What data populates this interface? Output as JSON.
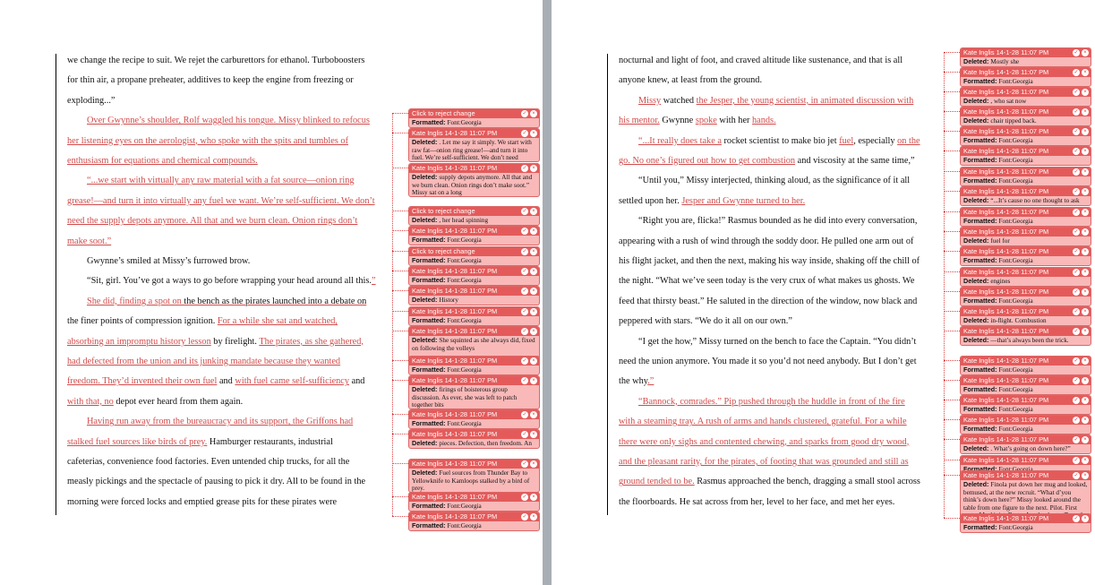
{
  "left_page": {
    "lines": [
      [
        {
          "t": "we change the recipe to suit. We rejet the carburettors for ethanol. Turboboosters"
        }
      ],
      [
        {
          "t": "for thin air, a propane preheater, additives to keep the engine from freezing or"
        }
      ],
      [
        {
          "t": "exploding...”"
        }
      ],
      [
        {
          "t": "Over Gwynne’s shoulder, Rolf waggled his tongue. Missy blinked to refocus",
          "c": "ins"
        }
      ],
      [
        {
          "t": "her listening eyes on the aerologist, who spoke with the spits and tumbles of",
          "c": "ins"
        }
      ],
      [
        {
          "t": "enthusiasm for equations and chemical compounds.",
          "c": "ins"
        }
      ],
      [
        {
          "t": "“...we start with virtually any raw material with a fat source—onion ring",
          "c": "ins"
        }
      ],
      [
        {
          "t": "grease!—and turn it into virtually any fuel we want. We’re self-sufficient. We don’t",
          "c": "ins"
        }
      ],
      [
        {
          "t": "need the supply depots anymore. All that and we burn clean. Onion rings don’t",
          "c": "ins"
        }
      ],
      [
        {
          "t": "make soot.”",
          "c": "ins"
        }
      ],
      [
        {
          "t": "Gwynne’s smiled at Missy’s furrowed brow."
        }
      ],
      [
        {
          "t": "“Sit, girl. You’ve got a ways to go before wrapping your head around all this."
        },
        {
          "t": "”",
          "c": "ins"
        }
      ],
      [
        {
          "t": "She did, finding a spot on ",
          "c": "ins"
        },
        {
          "t": "the bench as the pirates launched into a debate on",
          "c": "del"
        }
      ],
      [
        {
          "t": "the finer points of compression ignition. "
        },
        {
          "t": "For a while she sat and watched,",
          "c": "ins"
        }
      ],
      [
        {
          "t": "absorbing an impromptu history lesson",
          "c": "ins"
        },
        {
          "t": " by firelight. "
        },
        {
          "t": "The pirates, as she gathered,",
          "c": "ins"
        }
      ],
      [
        {
          "t": "had defected from the union and its junking mandate because they wanted",
          "c": "ins"
        }
      ],
      [
        {
          "t": "freedom. They’d invented their own fuel",
          "c": "ins"
        },
        {
          "t": " and "
        },
        {
          "t": "with fuel came self-sufficiency",
          "c": "ins"
        },
        {
          "t": " and"
        }
      ],
      [
        {
          "t": "with that, no",
          "c": "ins"
        },
        {
          "t": " depot ever heard from them again."
        }
      ],
      [
        {
          "t": "Having run away from the bureaucracy and its support, the Griffons had",
          "c": "ins"
        }
      ],
      [
        {
          "t": "stalked fuel sources like birds of prey.",
          "c": "ins"
        },
        {
          "t": " Hamburger restaurants, industrial"
        }
      ],
      [
        {
          "t": "cafeterias, convenience food factories. Even untended chip trucks, for all the"
        }
      ],
      [
        {
          "t": "measly pickings and the spectacle of pausing to pick it dry. All to be found in the"
        }
      ],
      [
        {
          "t": "morning were forced locks and emptied grease pits for these pirates were"
        }
      ]
    ],
    "balloons": [
      {
        "head": "Click to reject change",
        "label": "Formatted:",
        "text": "Font:Georgia"
      },
      {
        "head": "Kate Inglis 14-1-28 11:07 PM",
        "label": "Deleted:",
        "text": ". Let me say it simply. We start with raw fat—onion ring grease!—and turn it into fuel. We’re self-sufficient. We don’t need"
      },
      {
        "head": "Kate Inglis 14-1-28 11:07 PM",
        "label": "Deleted:",
        "text": "supply depots anymore. All that and we burn clean. Onion rings don’t make soot.” Missy sat on a long"
      },
      {
        "head": "Click to reject change",
        "label": "Deleted:",
        "text": ", her head spinning"
      },
      {
        "head": "Kate Inglis 14-1-28 11:07 PM",
        "label": "Formatted:",
        "text": "Font:Georgia"
      },
      {
        "head": "Click to reject change",
        "label": "Formatted:",
        "text": "Font:Georgia"
      },
      {
        "head": "Kate Inglis 14-1-28 11:07 PM",
        "label": "Formatted:",
        "text": "Font:Georgia"
      },
      {
        "head": "Kate Inglis 14-1-28 11:07 PM",
        "label": "Deleted:",
        "text": "History"
      },
      {
        "head": "Kate Inglis 14-1-28 11:07 PM",
        "label": "Formatted:",
        "text": "Font:Georgia"
      },
      {
        "head": "Kate Inglis 14-1-28 11:07 PM",
        "label": "Deleted:",
        "text": "She squinted as she always did, fixed on following the volleys"
      },
      {
        "head": "Kate Inglis 14-1-28 11:07 PM",
        "label": "Formatted:",
        "text": "Font:Georgia"
      },
      {
        "head": "Kate Inglis 14-1-28 11:07 PM",
        "label": "Deleted:",
        "text": "firings of boisterous group discussion. As ever, she was left to patch together bits"
      },
      {
        "head": "Kate Inglis 14-1-28 11:07 PM",
        "label": "Formatted:",
        "text": "Font:Georgia"
      },
      {
        "head": "Kate Inglis 14-1-28 11:07 PM",
        "label": "Deleted:",
        "text": "pieces. Defection, then freedom. An angry union. No"
      },
      {
        "head": "Kate Inglis 14-1-28 11:07 PM",
        "label": "Deleted:",
        "text": "Fuel sources from Thunder Bay to Yellowknife to Kamloops stalked by a bird of prey."
      },
      {
        "head": "Kate Inglis 14-1-28 11:07 PM",
        "label": "Formatted:",
        "text": "Font:Georgia"
      },
      {
        "head": "Kate Inglis 14-1-28 11:07 PM",
        "label": "Formatted:",
        "text": "Font:Georgia"
      }
    ]
  },
  "right_page": {
    "lines": [
      [
        {
          "t": "nocturnal and light of foot, and craved altitude like sustenance, and that is all"
        }
      ],
      [
        {
          "t": "anyone knew, at least from the ground."
        }
      ],
      [
        {
          "t": "Missy",
          "c": "ins"
        },
        {
          "t": " watched "
        },
        {
          "t": "the Jesper, the young scientist, in animated discussion with",
          "c": "ins"
        }
      ],
      [
        {
          "t": "his mentor.",
          "c": "ins"
        },
        {
          "t": " Gwynne "
        },
        {
          "t": "spoke",
          "c": "ins"
        },
        {
          "t": " with her "
        },
        {
          "t": "hands.",
          "c": "ins"
        }
      ],
      [
        {
          "t": "“...It really does take a",
          "c": "ins"
        },
        {
          "t": " rocket scientist to make bio jet "
        },
        {
          "t": "fuel",
          "c": "ins"
        },
        {
          "t": ", especially "
        },
        {
          "t": "on the",
          "c": "ins"
        }
      ],
      [
        {
          "t": "go. No one’s figured out how to get combustion",
          "c": "ins"
        },
        {
          "t": " and viscosity at the same time,”"
        }
      ],
      [
        {
          "t": "“Until you,” Missy interjected, thinking aloud, as the significance of it all"
        }
      ],
      [
        {
          "t": "settled upon her. "
        },
        {
          "t": "Jesper and Gwynne turned to her.",
          "c": "ins"
        }
      ],
      [
        {
          "t": "“Right you are, flicka!” Rasmus bounded as he did into every conversation,"
        }
      ],
      [
        {
          "t": "appearing with a rush of wind through the soddy door. He pulled one arm out of"
        }
      ],
      [
        {
          "t": "his flight jacket, and then the next, making his way inside, shaking off the chill of"
        }
      ],
      [
        {
          "t": "the night. “What we’ve seen today is the very crux of what makes us ghosts. We"
        }
      ],
      [
        {
          "t": "feed that thirsty beast.” He saluted in the direction of the window, now black and"
        }
      ],
      [
        {
          "t": "peppered with stars. “We do it all on our own.”"
        }
      ],
      [
        {
          "t": "“I get the how,” Missy turned on the bench to face the Captain. “You didn’t"
        }
      ],
      [
        {
          "t": "need the union anymore. You made it so you’d not need anybody. But I don’t get"
        }
      ],
      [
        {
          "t": "the why"
        },
        {
          "t": ".”",
          "c": "ins"
        }
      ],
      [
        {
          "t": "“Bannock, comrades.” Pip pushed through the huddle in front of the fire",
          "c": "ins"
        }
      ],
      [
        {
          "t": "with a steaming tray. A rush of arms and hands clustered, grateful. For a while",
          "c": "ins"
        }
      ],
      [
        {
          "t": "there were only sighs and contented chewing, and sparks from good dry wood,",
          "c": "ins"
        }
      ],
      [
        {
          "t": "and the pleasant rarity, for the pirates, of footing that was grounded and still as",
          "c": "ins"
        }
      ],
      [
        {
          "t": "ground tended to be.",
          "c": "ins"
        },
        {
          "t": " Rasmus approached the bench, dragging a small stool across"
        }
      ],
      [
        {
          "t": "the floorboards. He sat across from her, level to her face, and met her eyes."
        }
      ]
    ],
    "balloons": [
      {
        "head": "Kate Inglis 14-1-28 11:07 PM",
        "label": "Deleted:",
        "text": "Mostly she"
      },
      {
        "head": "Kate Inglis 14-1-28 11:07 PM",
        "label": "Formatted:",
        "text": "Font:Georgia"
      },
      {
        "head": "Kate Inglis 14-1-28 11:07 PM",
        "label": "Deleted:",
        "text": ", who sat now"
      },
      {
        "head": "Kate Inglis 14-1-28 11:07 PM",
        "label": "Deleted:",
        "text": "chair tipped back."
      },
      {
        "head": "Kate Inglis 14-1-28 11:07 PM",
        "label": "Formatted:",
        "text": "Font:Georgia"
      },
      {
        "head": "Kate Inglis 14-1-28 11:07 PM",
        "label": "Formatted:",
        "text": "Font:Georgia"
      },
      {
        "head": "Kate Inglis 14-1-28 11:07 PM",
        "label": "Formatted:",
        "text": "Font:Georgia"
      },
      {
        "head": "Kate Inglis 14-1-28 11:07 PM",
        "label": "Deleted:",
        "text": "“...It’s cause no one thought to ask"
      },
      {
        "head": "Kate Inglis 14-1-28 11:07 PM",
        "label": "Formatted:",
        "text": "Font:Georgia"
      },
      {
        "head": "Kate Inglis 14-1-28 11:07 PM",
        "label": "Deleted:",
        "text": "fuel for"
      },
      {
        "head": "Kate Inglis 14-1-28 11:07 PM",
        "label": "Formatted:",
        "text": "Font:Georgia"
      },
      {
        "head": "Kate Inglis 14-1-28 11:07 PM",
        "label": "Deleted:",
        "text": "engines"
      },
      {
        "head": "Kate Inglis 14-1-28 11:07 PM",
        "label": "Formatted:",
        "text": "Font:Georgia"
      },
      {
        "head": "Kate Inglis 14-1-28 11:07 PM",
        "label": "Deleted:",
        "text": "in-flight. Combustion"
      },
      {
        "head": "Kate Inglis 14-1-28 11:07 PM",
        "label": "Deleted:",
        "text": "—that’s always been the trick. Nobody could do it"
      },
      {
        "head": "Kate Inglis 14-1-28 11:07 PM",
        "label": "Formatted:",
        "text": "Font:Georgia"
      },
      {
        "head": "Kate Inglis 14-1-28 11:07 PM",
        "label": "Formatted:",
        "text": "Font:Georgia"
      },
      {
        "head": "Kate Inglis 14-1-28 11:07 PM",
        "label": "Formatted:",
        "text": "Font:Georgia"
      },
      {
        "head": "Kate Inglis 14-1-28 11:07 PM",
        "label": "Formatted:",
        "text": "Font:Georgia"
      },
      {
        "head": "Kate Inglis 14-1-28 11:07 PM",
        "label": "Deleted:",
        "text": ". What’s going on down here?”"
      },
      {
        "head": "Kate Inglis 14-1-28 11:07 PM",
        "label": "Formatted:",
        "text": "Font:Georgia"
      },
      {
        "head": "Kate Inglis 14-1-28 11:07 PM",
        "label": "Deleted:",
        "text": "Finola put down her mug and looked, bemused, at the new recruit. “What d’you think’s down here?” Missy looked around the table from one figure to the next. Pilot. First mate. Machinist. Brute. Another brute. Taro, the bladesmith, walke"
      },
      {
        "head": "Kate Inglis 14-1-28 11:07 PM",
        "label": "Formatted:",
        "text": "Font:Georgia"
      }
    ]
  },
  "controls": {
    "accept": "✓",
    "reject": "×",
    "more": "..."
  }
}
